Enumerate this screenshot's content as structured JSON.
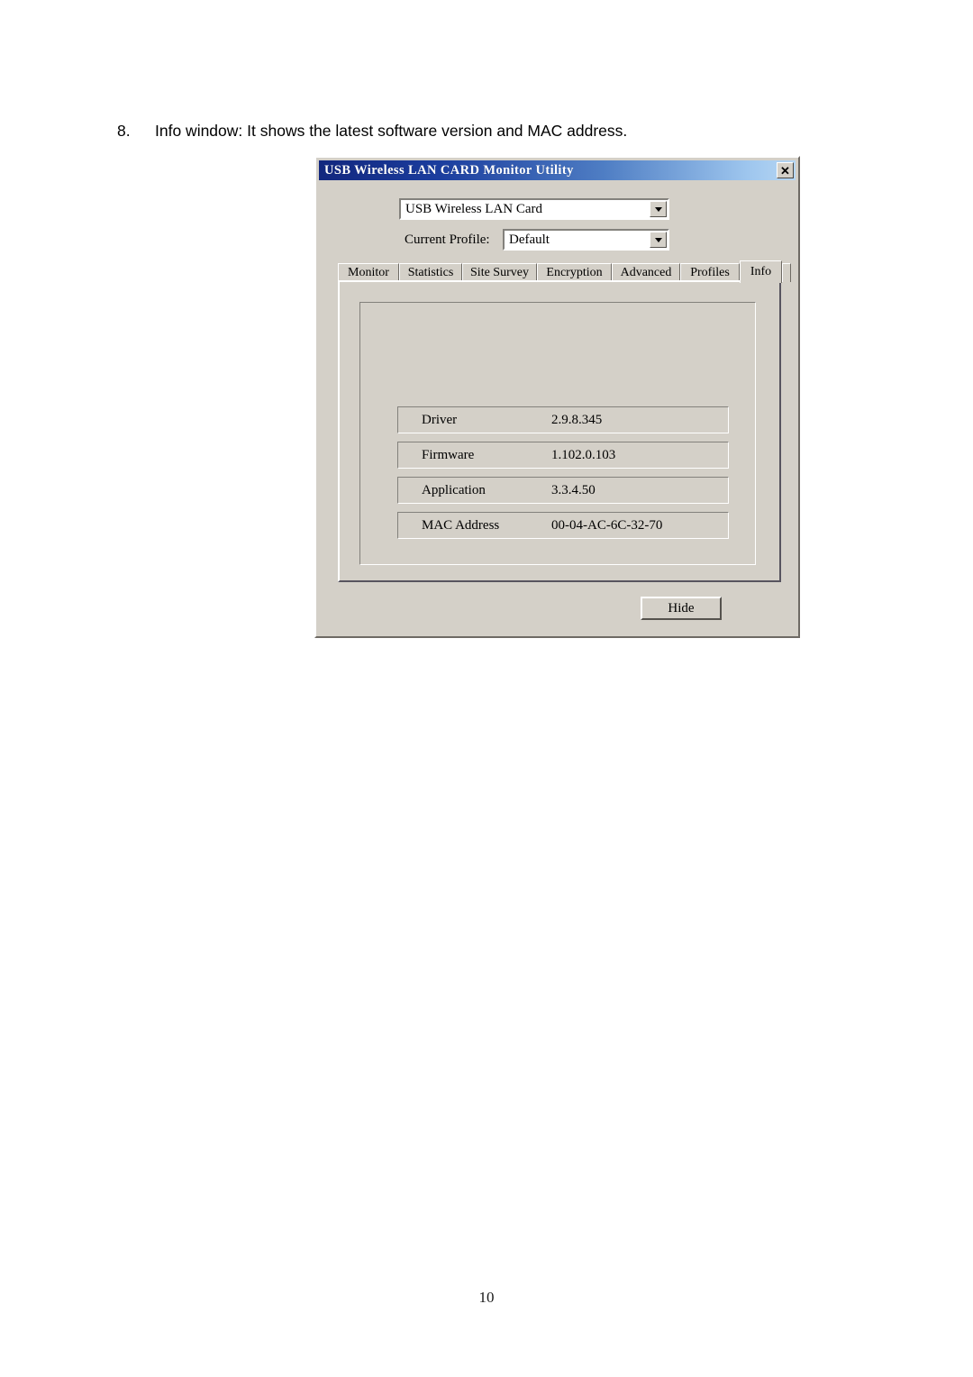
{
  "document": {
    "step_number": "8.",
    "step_text": "Info window: It shows the latest software version and MAC address.",
    "page_number": "10"
  },
  "window": {
    "title": "USB Wireless LAN CARD Monitor Utility",
    "close_glyph": "✕",
    "adapter_select": {
      "value": "USB Wireless LAN Card"
    },
    "profile": {
      "label": "Current Profile:",
      "value": "Default"
    },
    "tabs": [
      {
        "label": "Monitor",
        "active": false
      },
      {
        "label": "Statistics",
        "active": false
      },
      {
        "label": "Site Survey",
        "active": false
      },
      {
        "label": "Encryption",
        "active": false
      },
      {
        "label": "Advanced",
        "active": false
      },
      {
        "label": "Profiles",
        "active": false
      },
      {
        "label": "Info",
        "active": true
      }
    ],
    "info_rows": [
      {
        "label": "Driver",
        "value": "2.9.8.345"
      },
      {
        "label": "Firmware",
        "value": "1.102.0.103"
      },
      {
        "label": "Application",
        "value": "3.3.4.50"
      },
      {
        "label": "MAC Address",
        "value": "00-04-AC-6C-32-70"
      }
    ],
    "hide_button": "Hide"
  },
  "colors": {
    "window_face": "#d4d0c8",
    "titlebar_start": "#12277e",
    "titlebar_end": "#b6d6f3",
    "page_background": "#ffffff"
  }
}
